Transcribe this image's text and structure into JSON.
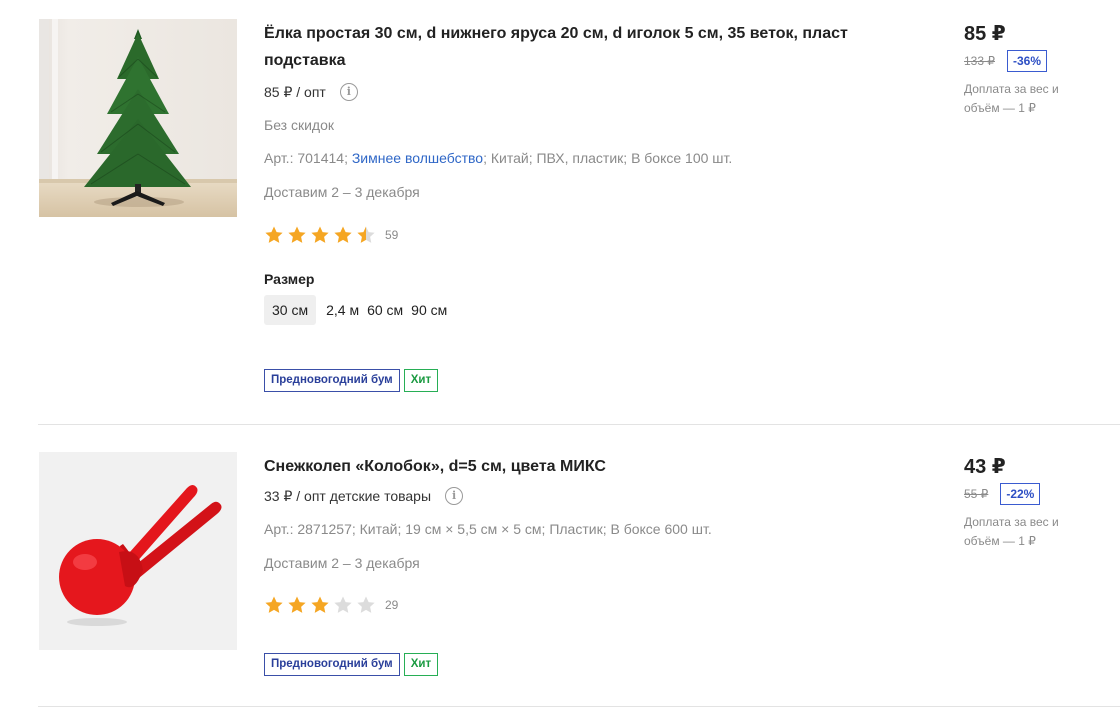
{
  "products": [
    {
      "title": "Ёлка простая 30 см, d нижнего яруса 20 см, d иголок 5 см, 35 веток, пласт подставка",
      "opt_price": "85 ₽ / опт",
      "discount_note": "Без скидок",
      "article": "Арт.: 701414",
      "brand_link": "Зимнее волшебство",
      "country": "Китай",
      "material": "ПВХ, пластик",
      "box": "В боксе 100 шт.",
      "delivery": "Доставим 2 – 3 декабря",
      "rating": 4.5,
      "rating_count": "59",
      "size_label": "Размер",
      "sizes": [
        "30 см",
        "2,4 м",
        "60 см",
        "90 см"
      ],
      "selected_size": "30 см",
      "badges": [
        "Предновогодний бум",
        "Хит"
      ],
      "price": "85 ₽",
      "old_price": "133 ₽",
      "discount": "-36%",
      "surcharge": "Доплата за вес и объём — 1 ₽"
    },
    {
      "title": "Снежколеп «Колобок», d=5 см, цвета МИКС",
      "opt_price": "33 ₽ / опт детские товары",
      "article": "Арт.: 2871257",
      "country": "Китай",
      "dimensions": "19 см × 5,5 см × 5 см",
      "material": "Пластик",
      "box": "В боксе 600 шт.",
      "delivery": "Доставим 2 – 3 декабря",
      "rating": 3,
      "rating_count": "29",
      "badges": [
        "Предновогодний бум",
        "Хит"
      ],
      "price": "43 ₽",
      "old_price": "55 ₽",
      "discount": "-22%",
      "surcharge": "Доплата за вес и объём — 1 ₽"
    }
  ],
  "colors": {
    "link": "#2f67c7",
    "star": "#f5a623",
    "star_empty": "#dcdcdc",
    "badge_blue": "#2a3f9a",
    "badge_green": "#1a9a40",
    "discount_blue": "#2d4fc4"
  }
}
